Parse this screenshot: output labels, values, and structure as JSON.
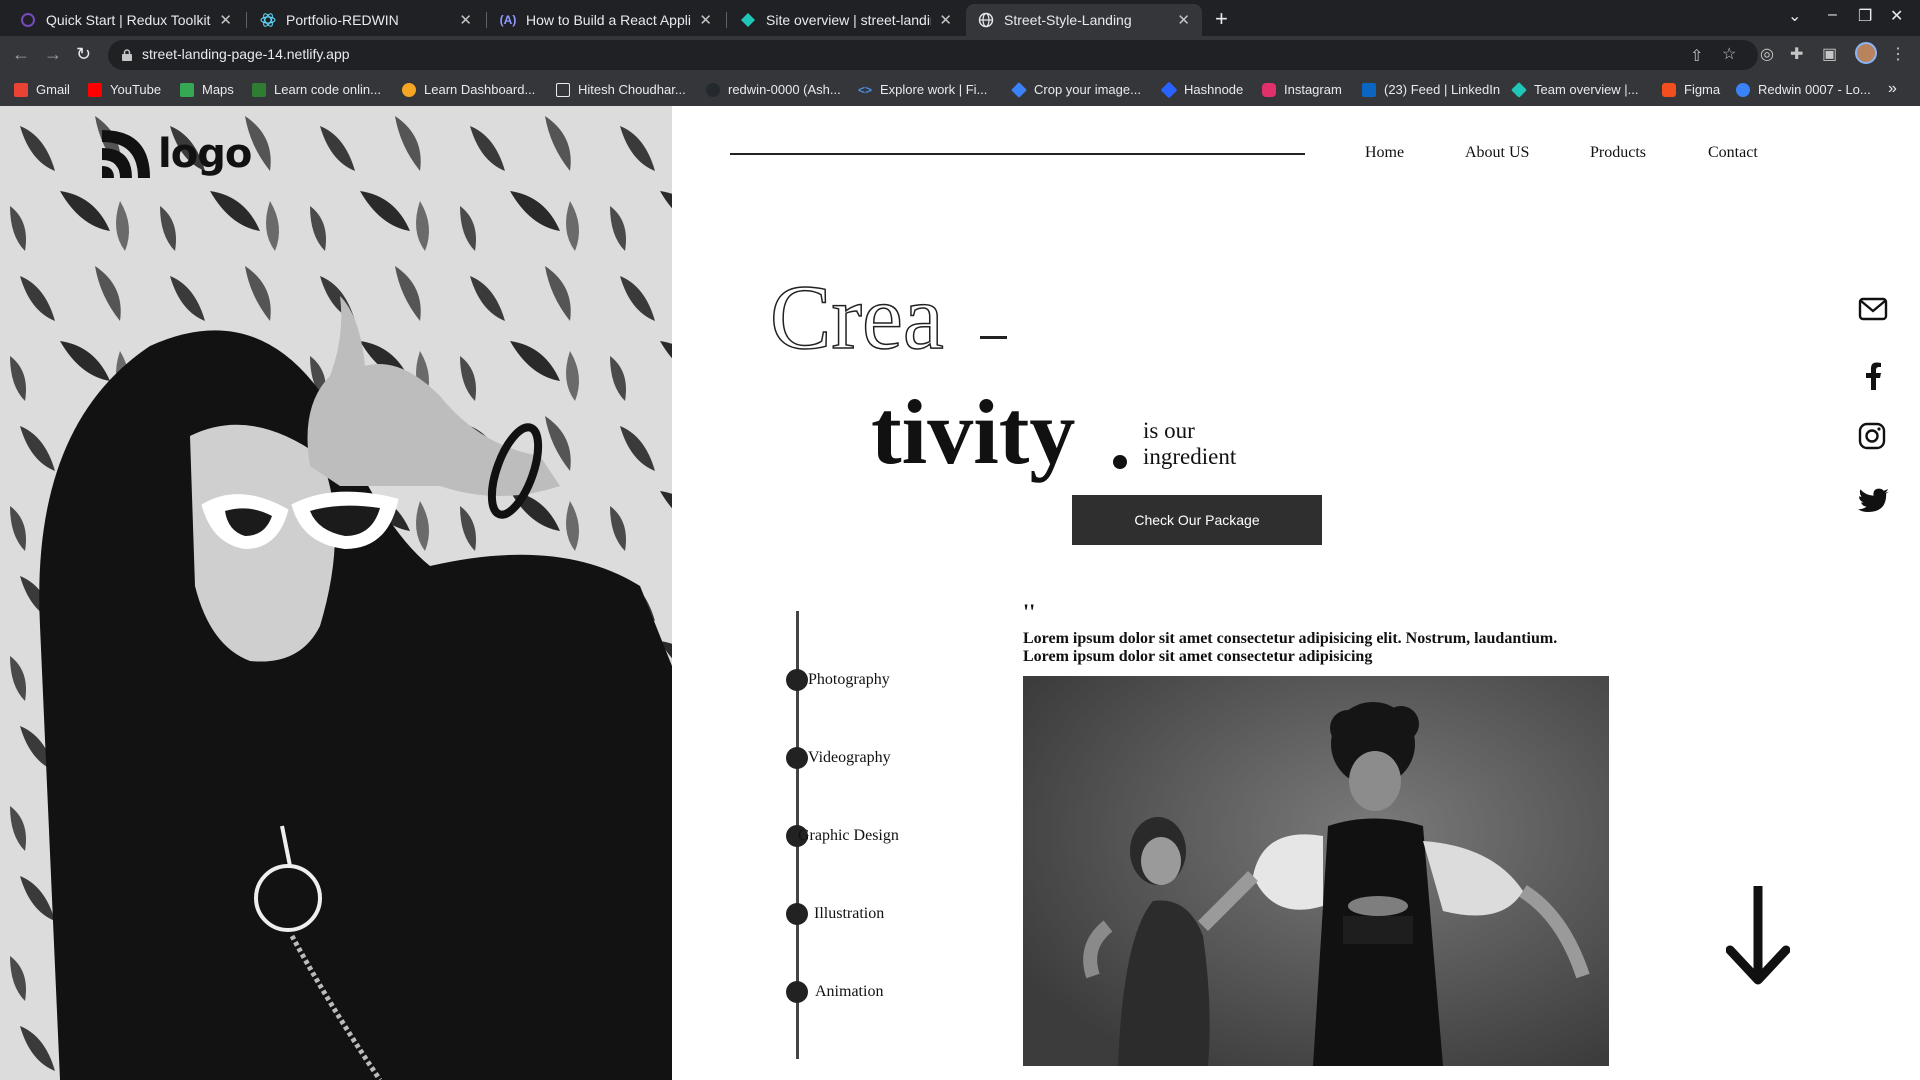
{
  "browser": {
    "tabs": [
      {
        "title": "Quick Start | Redux Toolkit",
        "icon": "redux-icon",
        "color": "#764abc"
      },
      {
        "title": "Portfolio-REDWIN",
        "icon": "react-icon",
        "color": "#61dafb"
      },
      {
        "title": "How to Build a React Applicat",
        "icon": "hashnode-a-icon",
        "color": "#8e9bff"
      },
      {
        "title": "Site overview | street-landing-",
        "icon": "netlify-icon",
        "color": "#20c6b7"
      },
      {
        "title": "Street-Style-Landing",
        "icon": "globe-icon",
        "color": "#e8eaed"
      }
    ],
    "active_tab": 4,
    "url": "street-landing-page-14.netlify.app",
    "bookmarks": [
      {
        "label": "Gmail",
        "color": "#ea4335"
      },
      {
        "label": "YouTube",
        "color": "#ff0000"
      },
      {
        "label": "Maps",
        "color": "#34a853"
      },
      {
        "label": "Learn code onlin...",
        "color": "#0a0a23"
      },
      {
        "label": "Learn Dashboard...",
        "color": "#f5a623"
      },
      {
        "label": "Hitesh Choudhar...",
        "color": "#111111"
      },
      {
        "label": "redwin-0000 (Ash...",
        "color": "#24292e"
      },
      {
        "label": "Explore work | Fi...",
        "color": "#4a90e2"
      },
      {
        "label": "Crop your image...",
        "color": "#3b82f6"
      },
      {
        "label": "Hashnode",
        "color": "#2962ff"
      },
      {
        "label": "Instagram",
        "color": "#e1306c"
      },
      {
        "label": "(23) Feed | LinkedIn",
        "color": "#0a66c2"
      },
      {
        "label": "Team overview |...",
        "color": "#20c6b7"
      },
      {
        "label": "Figma",
        "color": "#f24e1e"
      },
      {
        "label": "Redwin 0007 - Lo...",
        "color": "#3b82f6"
      }
    ]
  },
  "site": {
    "logo_text": "logo",
    "nav": [
      "Home",
      "About US",
      "Products",
      "Contact"
    ],
    "hero": {
      "line1": "Crea",
      "line2": "tivity",
      "tagline_1": "is our",
      "tagline_2": "ingredient",
      "cta_label": "Check Our Package"
    },
    "services": [
      "Photography",
      "Videography",
      "Graphic Design",
      "Illustration",
      "Animation"
    ],
    "quote_mark": "''",
    "quote_line_1": "Lorem ipsum dolor sit amet consectetur adipisicing elit. Nostrum, laudantium.",
    "quote_line_2": "Lorem ipsum dolor sit amet consectetur adipisicing",
    "social_icons": [
      "mail-icon",
      "facebook-icon",
      "instagram-icon",
      "twitter-icon"
    ]
  }
}
